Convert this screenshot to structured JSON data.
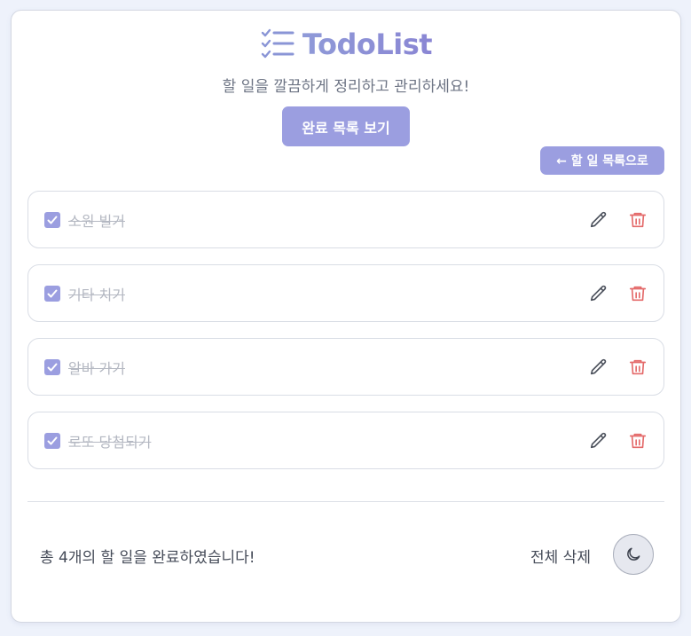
{
  "app": {
    "title": "TodoList",
    "subtitle": "할 일을 깔끔하게 정리하고 관리하세요!",
    "logo_icon": "checklist-icon"
  },
  "controls": {
    "toggle_label": "완료 목록 보기",
    "back_label": "← 할 일 목록으로"
  },
  "todos": [
    {
      "text": "소원 빌거",
      "completed": true
    },
    {
      "text": "기타 치기",
      "completed": true
    },
    {
      "text": "알바 가기",
      "completed": true
    },
    {
      "text": "로또 당첨되기",
      "completed": true
    }
  ],
  "footer": {
    "summary": "총 4개의 할 일을 완료하였습니다!",
    "delete_all_label": "전체 삭제",
    "theme_icon": "moon-icon"
  },
  "colors": {
    "accent": "#9b9ee0",
    "delete": "#e46a6a",
    "completed_text": "#b4b8c2"
  }
}
